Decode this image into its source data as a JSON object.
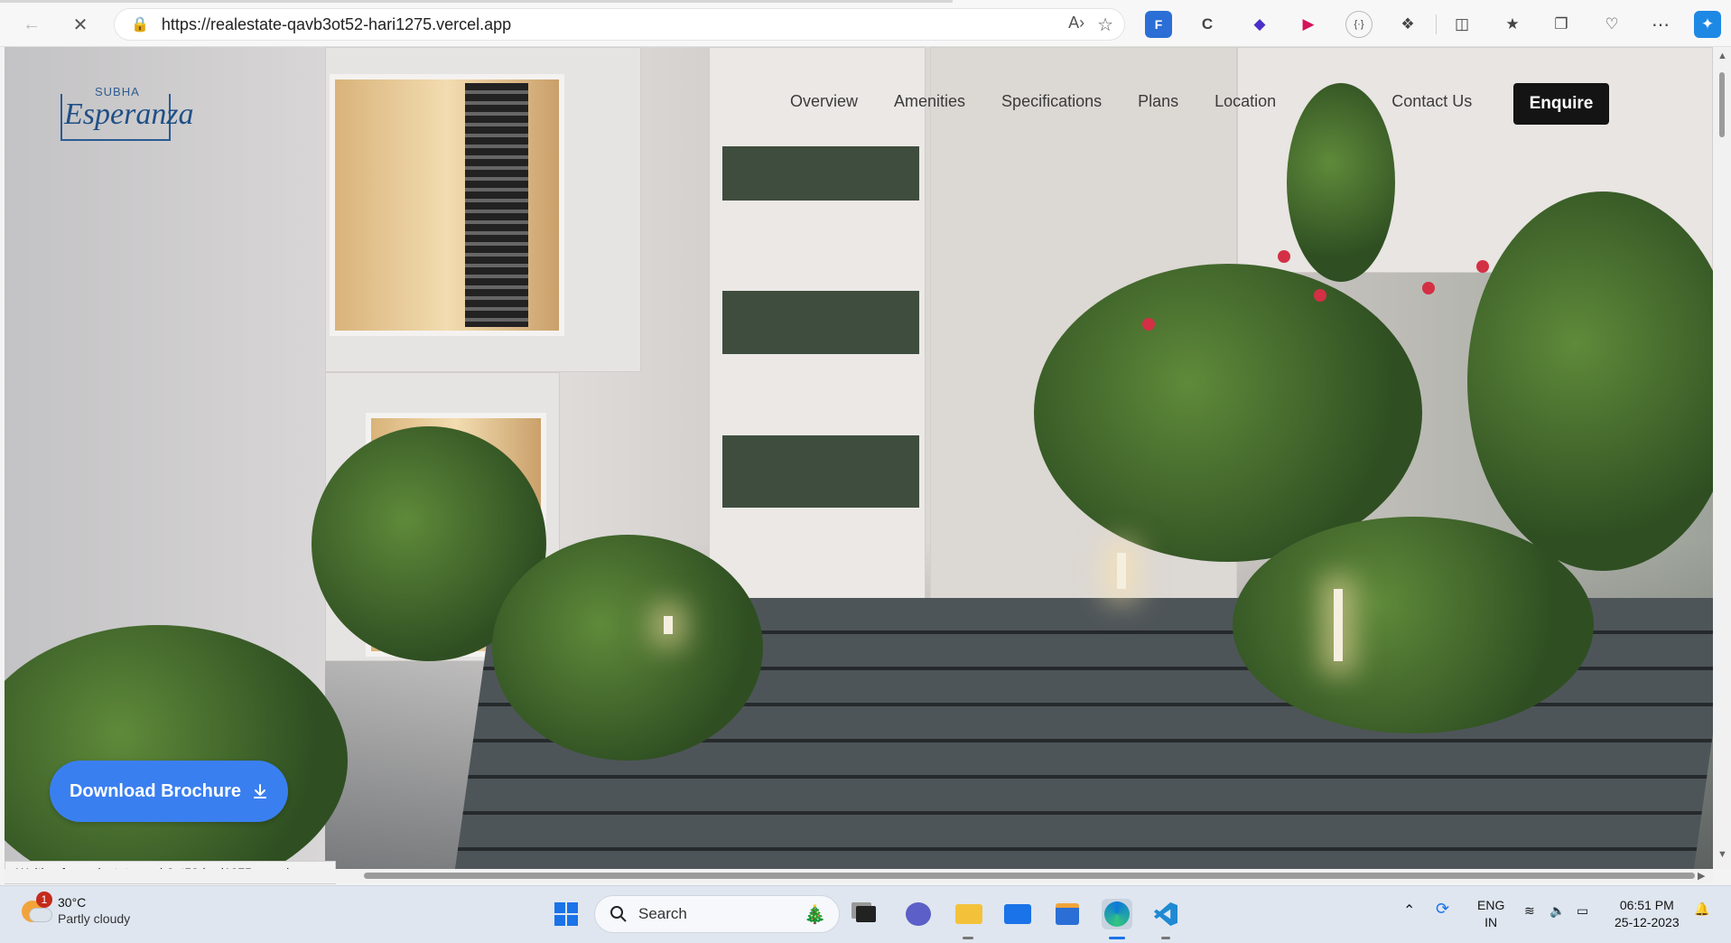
{
  "browser": {
    "url": "https://realestate-qavb3ot52-hari1275.vercel.app",
    "status_text": "Waiting for realestate-qavb3ot52-hari1275.vercel.app..."
  },
  "site": {
    "logo": {
      "top": "SUBHA",
      "main": "Esperanza"
    },
    "nav": [
      {
        "label": "Overview"
      },
      {
        "label": "Amenities"
      },
      {
        "label": "Specifications"
      },
      {
        "label": "Plans"
      },
      {
        "label": "Location"
      },
      {
        "label": "Contact Us"
      }
    ],
    "enquire_label": "Enquire",
    "brochure_label": "Download Brochure"
  },
  "taskbar": {
    "weather": {
      "temp": "30°C",
      "desc": "Partly cloudy",
      "badge": "1"
    },
    "search_label": "Search",
    "lang": {
      "line1": "ENG",
      "line2": "IN"
    },
    "clock": {
      "time": "06:51 PM",
      "date": "25-12-2023"
    }
  },
  "icons": {
    "back": "arrow-left-icon",
    "stop": "close-icon",
    "lock": "lock-icon",
    "read_aloud": "read-aloud-icon",
    "favorite": "star-icon"
  }
}
